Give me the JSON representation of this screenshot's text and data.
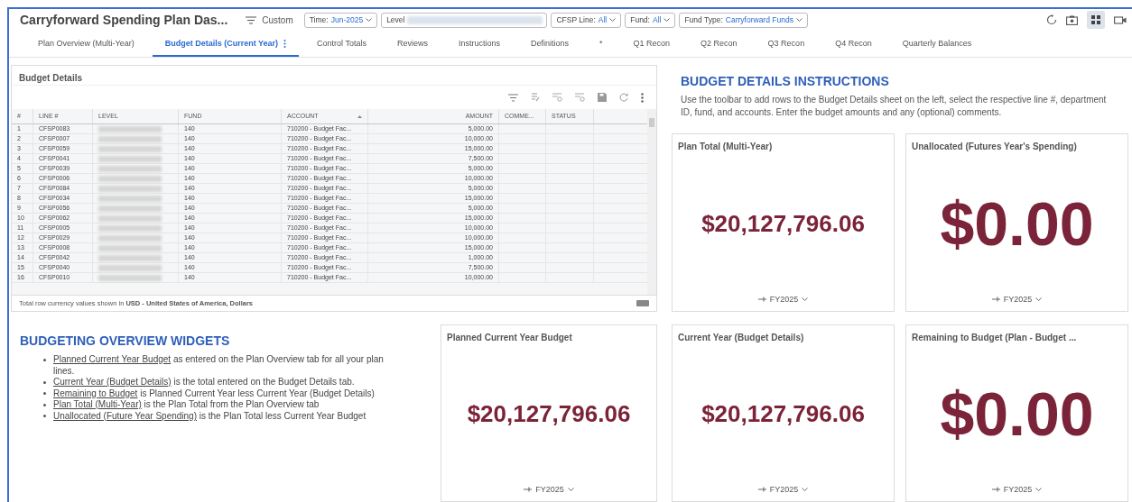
{
  "header": {
    "title": "Carryforward Spending Plan Das...",
    "view": "Custom",
    "filters": [
      {
        "label": "Time:",
        "value": "Jun-2025",
        "kind": "plain"
      },
      {
        "label": "Level",
        "kind": "redacted"
      },
      {
        "label": "CFSP Line:",
        "value": "All",
        "kind": "plain"
      },
      {
        "label": "Fund:",
        "value": "All",
        "kind": "plain"
      },
      {
        "label": "Fund Type:",
        "value": "Carryforward Funds",
        "kind": "plain"
      }
    ]
  },
  "tabs": [
    {
      "label": "Plan Overview (Multi-Year)",
      "selected": false
    },
    {
      "label": "Budget Details (Current Year)",
      "selected": true
    },
    {
      "label": "Control Totals",
      "selected": false
    },
    {
      "label": "Reviews",
      "selected": false
    },
    {
      "label": "Instructions",
      "selected": false
    },
    {
      "label": "Definitions",
      "selected": false
    },
    {
      "label": "*",
      "selected": false
    },
    {
      "label": "Q1 Recon",
      "selected": false
    },
    {
      "label": "Q2 Recon",
      "selected": false
    },
    {
      "label": "Q3 Recon",
      "selected": false
    },
    {
      "label": "Q4 Recon",
      "selected": false
    },
    {
      "label": "Quarterly Balances",
      "selected": false
    }
  ],
  "grid": {
    "title": "Budget Details",
    "columns": [
      "#",
      "LINE #",
      "LEVEL",
      "FUND",
      "ACCOUNT",
      "AMOUNT",
      "COMME...",
      "STATUS"
    ],
    "rows": [
      [
        "1",
        "CFSP0083",
        "",
        "140",
        "710200 - Budget Fac...",
        "5,000.00"
      ],
      [
        "2",
        "CFSP0007",
        "",
        "140",
        "710200 - Budget Fac...",
        "10,000.00"
      ],
      [
        "3",
        "CFSP0059",
        "",
        "140",
        "710200 - Budget Fac...",
        "15,000.00"
      ],
      [
        "4",
        "CFSP0041",
        "",
        "140",
        "710200 - Budget Fac...",
        "7,500.00"
      ],
      [
        "5",
        "CFSP0039",
        "",
        "140",
        "710200 - Budget Fac...",
        "5,000.00"
      ],
      [
        "6",
        "CFSP0006",
        "",
        "140",
        "710200 - Budget Fac...",
        "10,000.00"
      ],
      [
        "7",
        "CFSP0084",
        "",
        "140",
        "710200 - Budget Fac...",
        "5,000.00"
      ],
      [
        "8",
        "CFSP0034",
        "",
        "140",
        "710200 - Budget Fac...",
        "15,000.00"
      ],
      [
        "9",
        "CFSP0056",
        "",
        "140",
        "710200 - Budget Fac...",
        "5,000.00"
      ],
      [
        "10",
        "CFSP0062",
        "",
        "140",
        "710200 - Budget Fac...",
        "15,000.00"
      ],
      [
        "11",
        "CFSP0005",
        "",
        "140",
        "710200 - Budget Fac...",
        "10,000.00"
      ],
      [
        "12",
        "CFSP0029",
        "",
        "140",
        "710200 - Budget Fac...",
        "10,000.00"
      ],
      [
        "13",
        "CFSP0008",
        "",
        "140",
        "710200 - Budget Fac...",
        "15,000.00"
      ],
      [
        "14",
        "CFSP0042",
        "",
        "140",
        "710200 - Budget Fac...",
        "1,000.00"
      ],
      [
        "15",
        "CFSP0040",
        "",
        "140",
        "710200 - Budget Fac...",
        "7,500.00"
      ],
      [
        "16",
        "CFSP0010",
        "",
        "140",
        "710200 - Budget Fac...",
        "10,000.00"
      ]
    ],
    "footer": "Total row currency values shown in **USD - United States of America, Dollars**"
  },
  "instructions": {
    "title": "BUDGET DETAILS INSTRUCTIONS",
    "text": "Use the toolbar to add rows to the Budget Details sheet on the left, select the respective line #, department ID, fund, and accounts. Enter the budget amounts and any (optional) comments."
  },
  "overview": {
    "title": "BUDGETING OVERVIEW WIDGETS",
    "items": [
      {
        "term": "Planned Current Year Budget",
        "text": " as entered on the Plan Overview tab for all your plan lines."
      },
      {
        "term": "Current Year (Budget Details)",
        "text": " is the total entered on the Budget Details tab."
      },
      {
        "term": "Remaining to Budget",
        "text": " is Planned Current Year less Current Year (Budget Details)"
      },
      {
        "term": "Plan Total (Multi-Year)",
        "text": " is the Plan Total from the Plan Overview tab"
      },
      {
        "term": "Unallocated (Future Year Spending)",
        "text": " is the Plan Total less Current Year Budget"
      }
    ]
  },
  "widgets": [
    {
      "title": "Plan Total (Multi-Year)",
      "value": "$20,127,796.06",
      "period": "FY2025",
      "kind": "medium"
    },
    {
      "title": "Unallocated (Futures Year's Spending)",
      "value": "$0.00",
      "period": "FY2025",
      "kind": "large"
    },
    {
      "title": "Planned Current Year Budget",
      "value": "$20,127,796.06",
      "period": "FY2025",
      "kind": "medium"
    },
    {
      "title": "Current Year (Budget Details)",
      "value": "$20,127,796.06",
      "period": "FY2025",
      "kind": "medium"
    },
    {
      "title": "Remaining to Budget (Plan - Budget ...",
      "value": "$0.00",
      "period": "FY2025",
      "kind": "large"
    }
  ]
}
